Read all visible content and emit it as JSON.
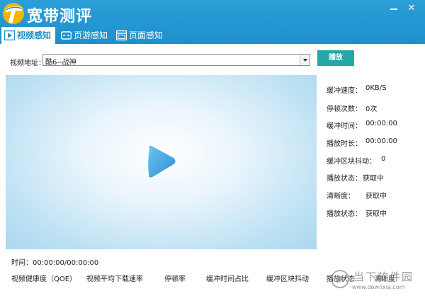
{
  "app": {
    "title": "宽带测评"
  },
  "tabs": [
    {
      "label": "视频感知"
    },
    {
      "label": "页游感知"
    },
    {
      "label": "页面感知"
    }
  ],
  "url": {
    "label": "视频地址：",
    "value": "酷6--战神"
  },
  "play_button": "播放",
  "stats": {
    "buffer_speed": {
      "label": "缓冲速度：",
      "value": "0KB/S"
    },
    "stall_count": {
      "label": "停顿次数：",
      "value": "0次"
    },
    "buffer_time": {
      "label": "缓冲时间：",
      "value": "00:00:00"
    },
    "play_duration": {
      "label": "播放时长：",
      "value": "00:00:00"
    },
    "buffer_jitter": {
      "label": "缓冲区块抖动：",
      "value": "0"
    },
    "play_status": {
      "label": "播放状态：",
      "value": "获取中"
    },
    "clarity": {
      "label": "清晰度：",
      "value": "获取中"
    },
    "play_status_2": {
      "label": "播放状态：",
      "value": "获取中"
    }
  },
  "time": "时间：00:00:00/00:00:00",
  "metrics_headers": [
    "视频健康度（QOE）",
    "视频平均下载速率",
    "停顿率",
    "缓冲时间占比",
    "缓冲区块抖动",
    "播放状态",
    "清晰度"
  ],
  "watermark": {
    "text": "当下软件园",
    "url": "www.downxia.com"
  },
  "colors": {
    "titlebar": "#1e8fcc",
    "accent": "#26a7a8",
    "tab_active_text": "#1e8fcc"
  }
}
